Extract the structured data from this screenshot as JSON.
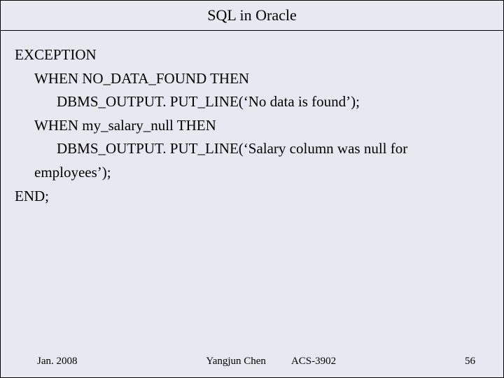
{
  "header": {
    "title": "SQL in Oracle"
  },
  "code": {
    "l1": "EXCEPTION",
    "l2": "WHEN NO_DATA_FOUND THEN",
    "l3": "DBMS_OUTPUT. PUT_LINE(‘No data is found’);",
    "l4": "WHEN my_salary_null THEN",
    "l5a": "DBMS_OUTPUT. PUT_LINE(‘Salary column was null for",
    "l5b": "employees’);",
    "l6": "END;"
  },
  "footer": {
    "date": "Jan. 2008",
    "author": "Yangjun Chen",
    "course": "ACS-3902",
    "page": "56"
  }
}
